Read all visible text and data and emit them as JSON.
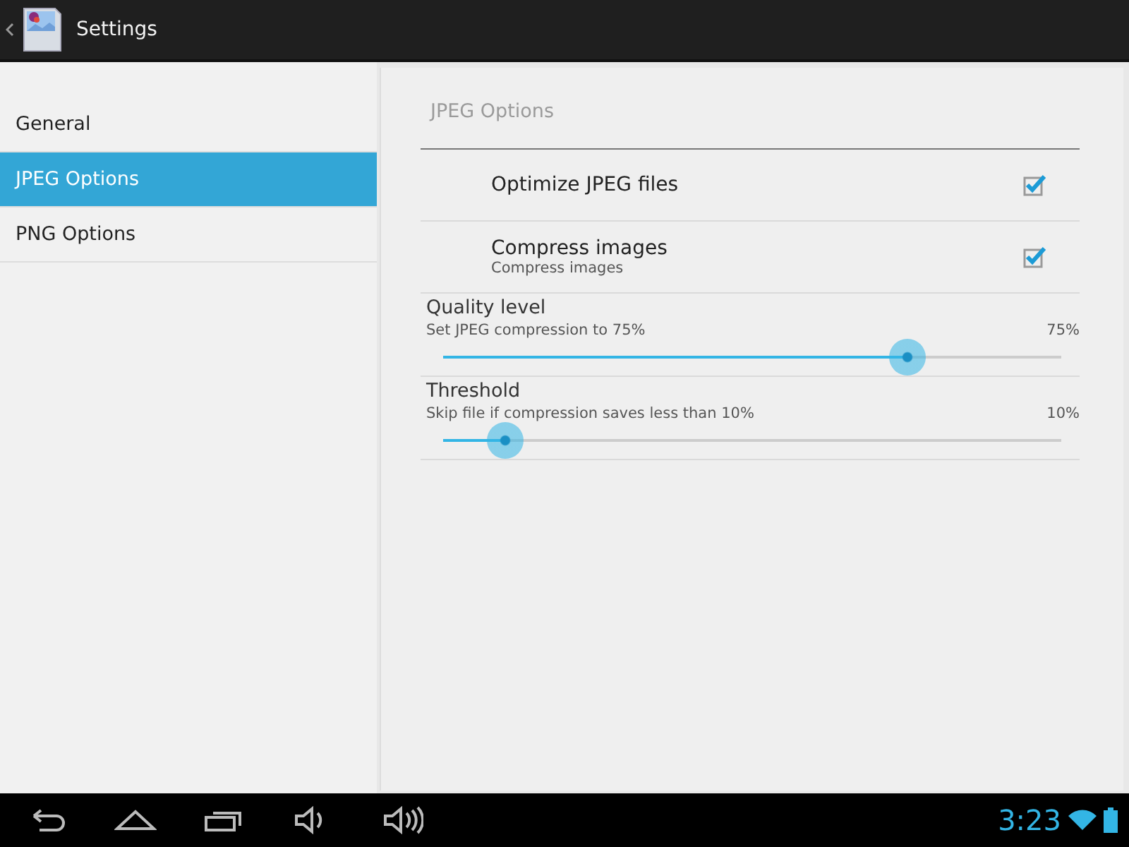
{
  "action_bar": {
    "title": "Settings"
  },
  "sidebar": {
    "items": [
      {
        "label": "General",
        "selected": false
      },
      {
        "label": "JPEG Options",
        "selected": true
      },
      {
        "label": "PNG Options",
        "selected": false
      }
    ]
  },
  "content": {
    "heading": "JPEG Options",
    "preferences": [
      {
        "kind": "checkbox",
        "title": "Optimize JPEG files",
        "checked": true
      },
      {
        "kind": "checkbox",
        "title": "Compress images",
        "summary": "Compress images",
        "checked": true
      },
      {
        "kind": "slider",
        "title": "Quality level",
        "summary": "Set JPEG compression to 75%",
        "reading": "75%",
        "level": 0.75
      },
      {
        "kind": "slider",
        "title": "Threshold",
        "summary": "Skip file if compression saves less than 10%",
        "reading": "10%",
        "level": 0.1
      }
    ]
  },
  "status_bar": {
    "time": "3:23"
  }
}
